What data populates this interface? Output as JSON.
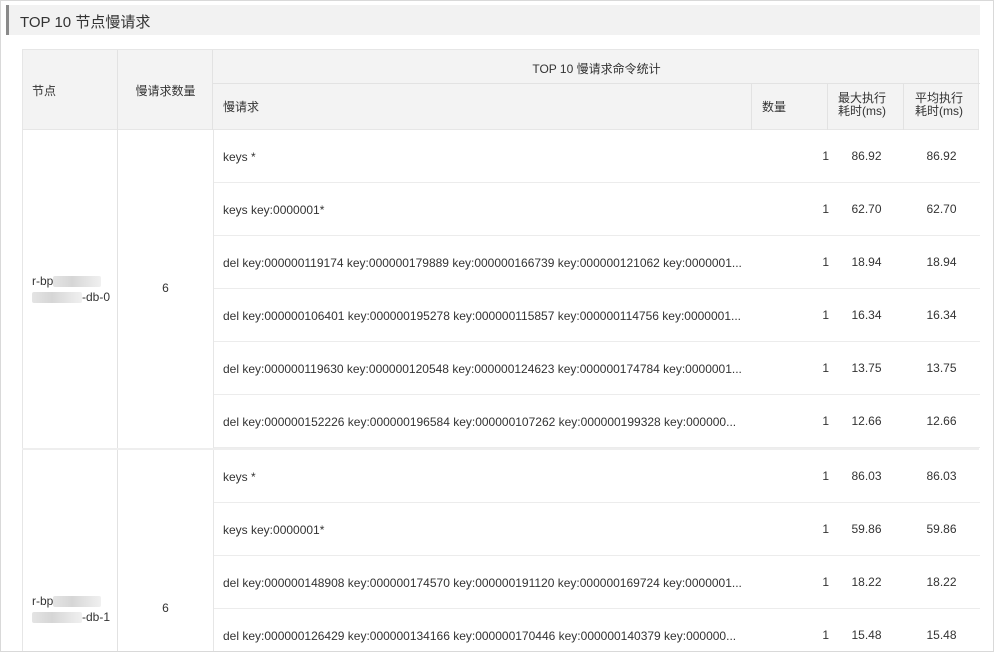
{
  "section": {
    "title": "TOP 10 节点慢请求"
  },
  "table": {
    "headers": {
      "node": "节点",
      "slow_count": "慢请求数量",
      "group": "TOP 10 慢请求命令统计",
      "command": "慢请求",
      "count": "数量",
      "max_time_line1": "最大执行",
      "max_time_line2": "耗时(ms)",
      "avg_time_line1": "平均执行",
      "avg_time_line2": "耗时(ms)"
    },
    "groups": [
      {
        "node_prefix": "r-bp",
        "node_suffix": "-db-0",
        "slow_count": "6",
        "rows": [
          {
            "command": "keys *",
            "count": "1",
            "max": "86.92",
            "avg": "86.92"
          },
          {
            "command": "keys key:0000001*",
            "count": "1",
            "max": "62.70",
            "avg": "62.70"
          },
          {
            "command": "del key:000000119174 key:000000179889 key:000000166739 key:000000121062 key:0000001...",
            "count": "1",
            "max": "18.94",
            "avg": "18.94"
          },
          {
            "command": "del key:000000106401 key:000000195278 key:000000115857 key:000000114756 key:0000001...",
            "count": "1",
            "max": "16.34",
            "avg": "16.34"
          },
          {
            "command": "del key:000000119630 key:000000120548 key:000000124623 key:000000174784 key:0000001...",
            "count": "1",
            "max": "13.75",
            "avg": "13.75"
          },
          {
            "command": "del key:000000152226 key:000000196584 key:000000107262 key:000000199328 key:000000...",
            "count": "1",
            "max": "12.66",
            "avg": "12.66"
          }
        ]
      },
      {
        "node_prefix": "r-bp",
        "node_suffix": "-db-1",
        "slow_count": "6",
        "rows": [
          {
            "command": "keys *",
            "count": "1",
            "max": "86.03",
            "avg": "86.03"
          },
          {
            "command": "keys key:0000001*",
            "count": "1",
            "max": "59.86",
            "avg": "59.86"
          },
          {
            "command": "del key:000000148908 key:000000174570 key:000000191120 key:000000169724 key:0000001...",
            "count": "1",
            "max": "18.22",
            "avg": "18.22"
          },
          {
            "command": "del key:000000126429 key:000000134166 key:000000170446 key:000000140379 key:000000...",
            "count": "1",
            "max": "15.48",
            "avg": "15.48"
          }
        ]
      }
    ]
  }
}
